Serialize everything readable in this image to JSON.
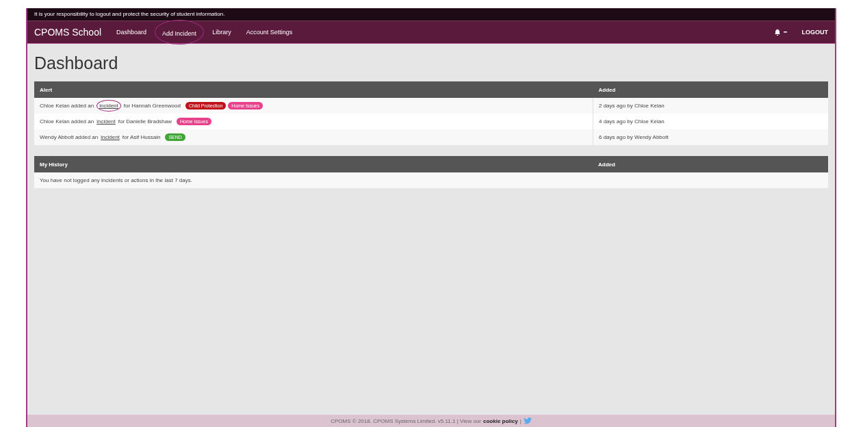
{
  "notice": "It is your responsibility to logout and protect the security of student information.",
  "navbar": {
    "brand": "CPOMS School",
    "items": [
      {
        "label": "Dashboard",
        "circled": false
      },
      {
        "label": "Add Incident",
        "circled": true
      },
      {
        "label": "Library",
        "circled": false
      },
      {
        "label": "Account Settings",
        "circled": false
      }
    ],
    "logout": "LOGOUT"
  },
  "page_title": "Dashboard",
  "alerts": {
    "columns": [
      "Alert",
      "Added"
    ],
    "rows": [
      {
        "before": "Chloe Kelan added an",
        "link": "incident",
        "after": "for Hannah Greenwood",
        "circled": true,
        "tags": [
          {
            "label": "Child Protection",
            "color": "#c0101a"
          },
          {
            "label": "Home Issues",
            "color": "#e8408a"
          }
        ],
        "added": "2 days ago by Chloe Kelan"
      },
      {
        "before": "Chloe Kelan added an",
        "link": "incident",
        "after": "for Danielle Bradshaw",
        "circled": false,
        "tags": [
          {
            "label": "Home Issues",
            "color": "#e8408a"
          }
        ],
        "added": "4 days ago by Chloe Kelan"
      },
      {
        "before": "Wendy Abbott added an",
        "link": "incident",
        "after": "for Asif Hussain",
        "circled": false,
        "tags": [
          {
            "label": "SEND",
            "color": "#3fa535"
          }
        ],
        "added": "6 days ago by Wendy Abbott"
      }
    ]
  },
  "history": {
    "columns": [
      "My History",
      "Added"
    ],
    "empty": "You have not logged any incidents or actions in the last 7 days."
  },
  "footer": {
    "text": "CPOMS © 2018. CPOMS Systems Limited. v5.11.1 | View our",
    "link": "cookie policy",
    "separator": "|"
  }
}
